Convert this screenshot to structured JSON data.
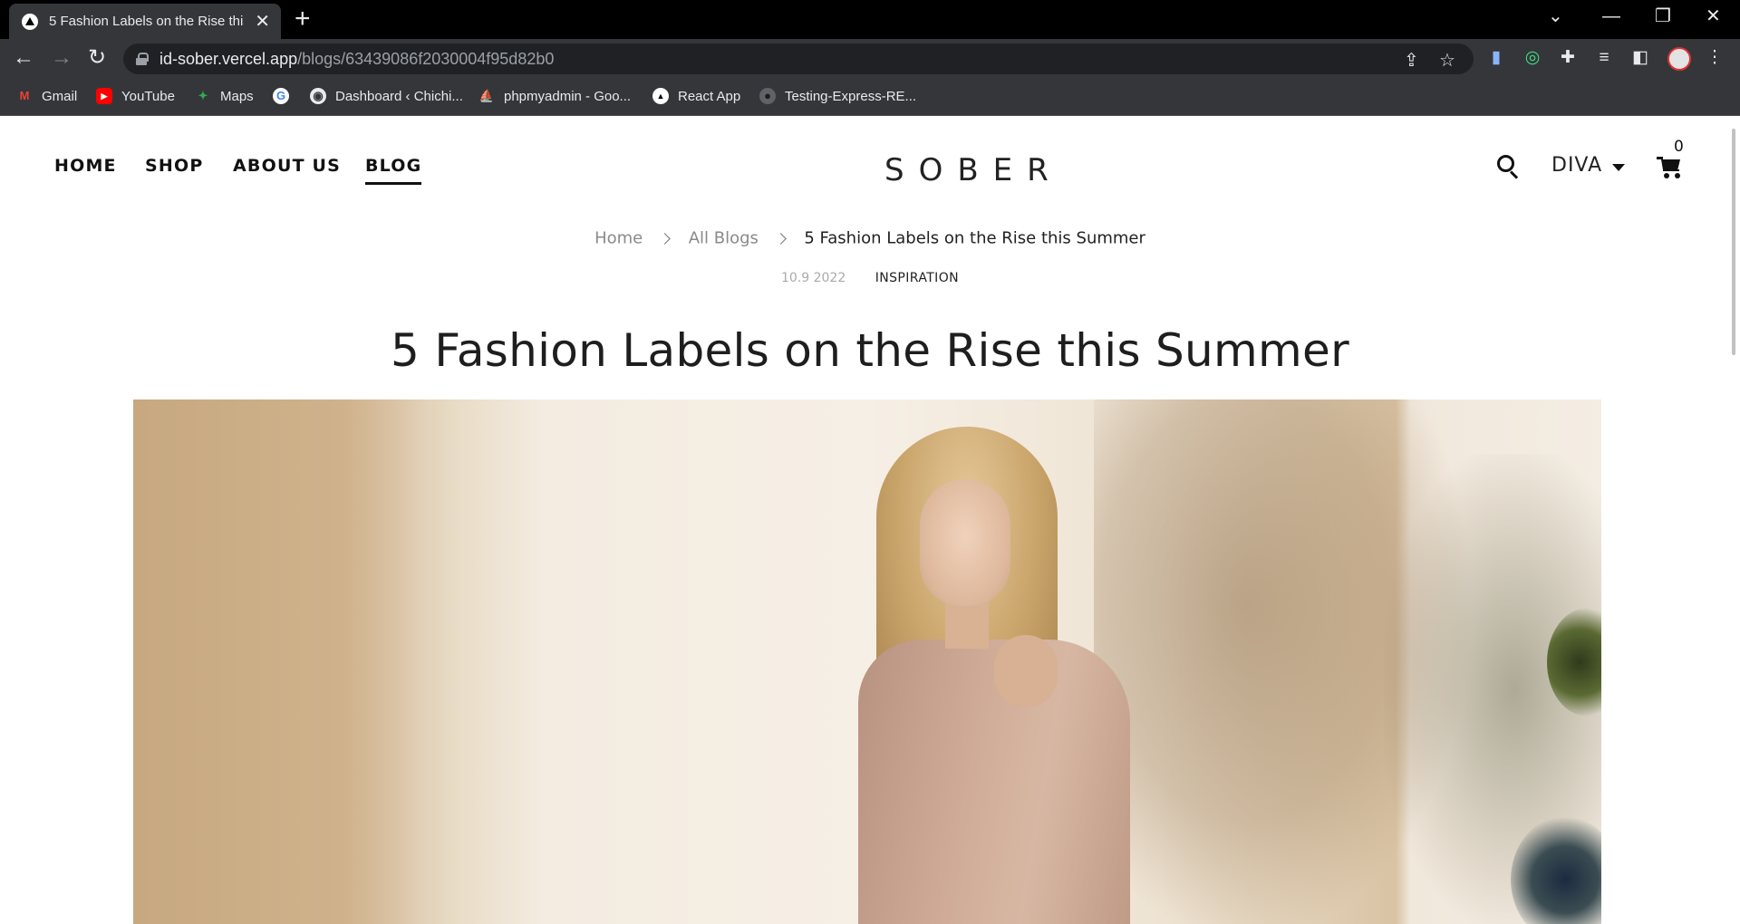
{
  "browser": {
    "tab_title": "5 Fashion Labels on the Rise this",
    "url_host": "id-sober.vercel.app",
    "url_path": "/blogs/63439086f2030004f95d82b0",
    "bookmarks": [
      {
        "label": "Gmail",
        "icon": "gmail-icon",
        "color": "#ea4335"
      },
      {
        "label": "YouTube",
        "icon": "youtube-icon",
        "color": "#ff0000"
      },
      {
        "label": "Maps",
        "icon": "maps-icon",
        "color": "#34a853"
      },
      {
        "label": "",
        "icon": "google-icon",
        "color": "#4285f4"
      },
      {
        "label": "Dashboard ‹ Chichi...",
        "icon": "globe-icon",
        "color": "#e8eaed"
      },
      {
        "label": "phpmyadmin - Goo...",
        "icon": "phpmyadmin-icon",
        "color": "#f29111"
      },
      {
        "label": "React App",
        "icon": "react-app-icon",
        "color": "#ffffff"
      },
      {
        "label": "Testing-Express-RE...",
        "icon": "github-icon",
        "color": "#e8eaed"
      }
    ]
  },
  "site": {
    "nav": {
      "home": "HOME",
      "shop": "SHOP",
      "about": "ABOUT US",
      "blog": "BLOG"
    },
    "logo": "SOBER",
    "language": "DIVA",
    "cart_count": "0"
  },
  "post": {
    "breadcrumb": {
      "home": "Home",
      "all_blogs": "All Blogs",
      "current": "5 Fashion Labels on the Rise this Summer"
    },
    "date": "10.9 2022",
    "category": "INSPIRATION",
    "title": "5 Fashion Labels on the Rise this Summer"
  }
}
